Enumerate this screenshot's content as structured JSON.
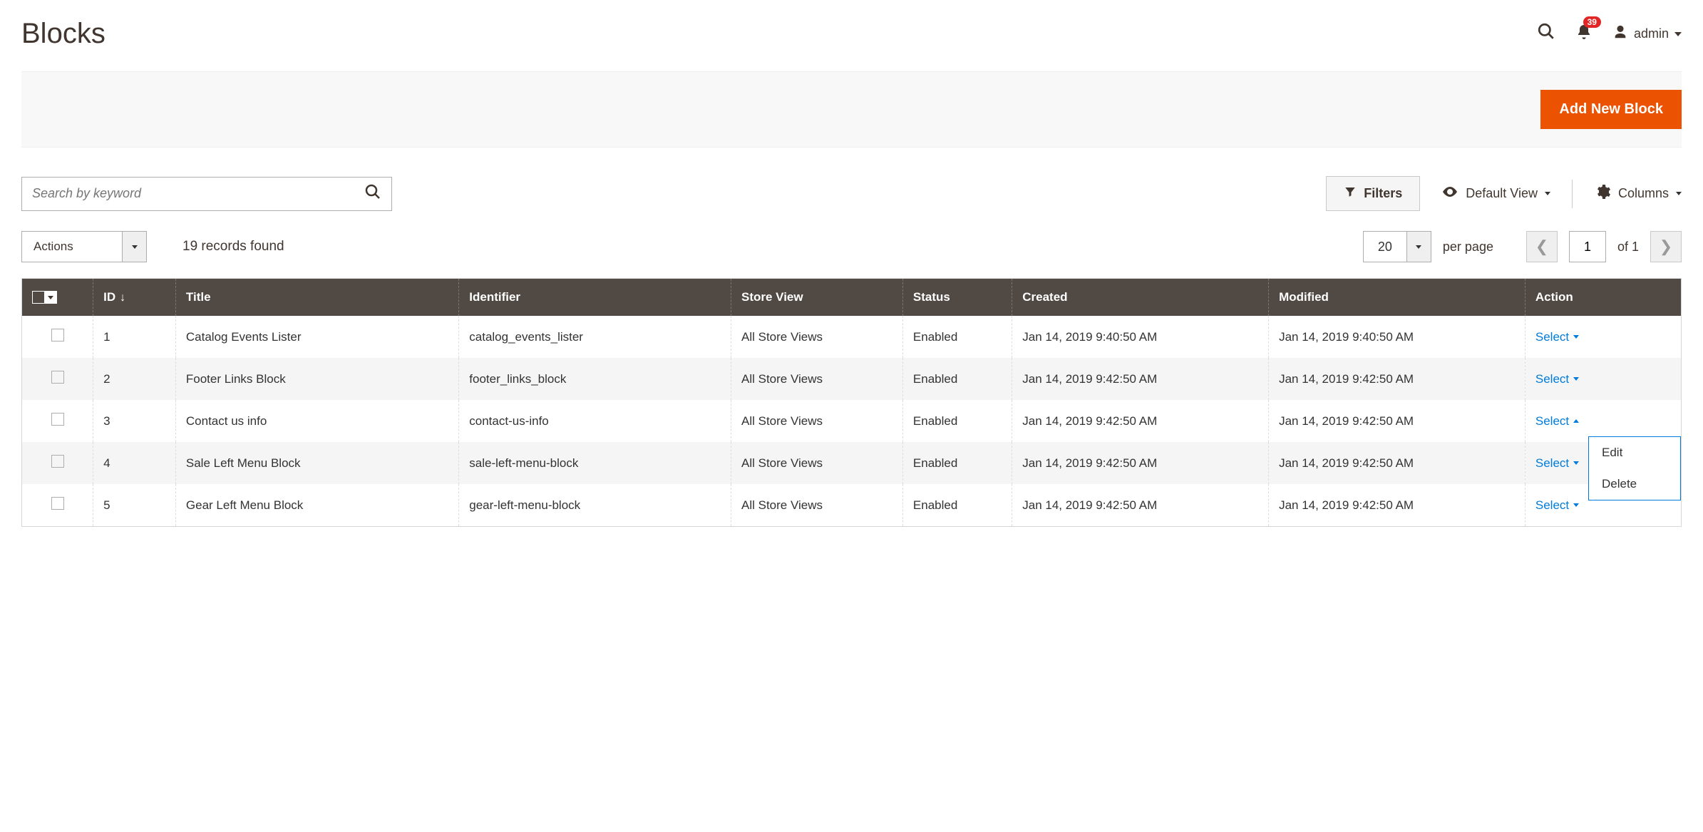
{
  "page_title": "Blocks",
  "header": {
    "notification_count": "39",
    "user_label": "admin"
  },
  "action_bar": {
    "add_button": "Add New Block"
  },
  "toolbar": {
    "search_placeholder": "Search by keyword",
    "filters_label": "Filters",
    "default_view_label": "Default View",
    "columns_label": "Columns"
  },
  "controls": {
    "actions_label": "Actions",
    "records_found": "19 records found",
    "page_size": "20",
    "per_page_label": "per page",
    "page_current": "1",
    "of_label": "of 1"
  },
  "columns": {
    "id": "ID",
    "title": "Title",
    "identifier": "Identifier",
    "store_view": "Store View",
    "status": "Status",
    "created": "Created",
    "modified": "Modified",
    "action": "Action"
  },
  "rows": [
    {
      "id": "1",
      "title": "Catalog Events Lister",
      "identifier": "catalog_events_lister",
      "store_view": "All Store Views",
      "status": "Enabled",
      "created": "Jan 14, 2019 9:40:50 AM",
      "modified": "Jan 14, 2019 9:40:50 AM",
      "action": "Select",
      "open": false
    },
    {
      "id": "2",
      "title": "Footer Links Block",
      "identifier": "footer_links_block",
      "store_view": "All Store Views",
      "status": "Enabled",
      "created": "Jan 14, 2019 9:42:50 AM",
      "modified": "Jan 14, 2019 9:42:50 AM",
      "action": "Select",
      "open": false
    },
    {
      "id": "3",
      "title": "Contact us info",
      "identifier": "contact-us-info",
      "store_view": "All Store Views",
      "status": "Enabled",
      "created": "Jan 14, 2019 9:42:50 AM",
      "modified": "Jan 14, 2019 9:42:50 AM",
      "action": "Select",
      "open": true
    },
    {
      "id": "4",
      "title": "Sale Left Menu Block",
      "identifier": "sale-left-menu-block",
      "store_view": "All Store Views",
      "status": "Enabled",
      "created": "Jan 14, 2019 9:42:50 AM",
      "modified": "Jan 14, 2019 9:42:50 AM",
      "action": "Select",
      "open": false
    },
    {
      "id": "5",
      "title": "Gear Left Menu Block",
      "identifier": "gear-left-menu-block",
      "store_view": "All Store Views",
      "status": "Enabled",
      "created": "Jan 14, 2019 9:42:50 AM",
      "modified": "Jan 14, 2019 9:42:50 AM",
      "action": "Select",
      "open": false
    }
  ],
  "action_menu": {
    "edit": "Edit",
    "delete": "Delete"
  }
}
